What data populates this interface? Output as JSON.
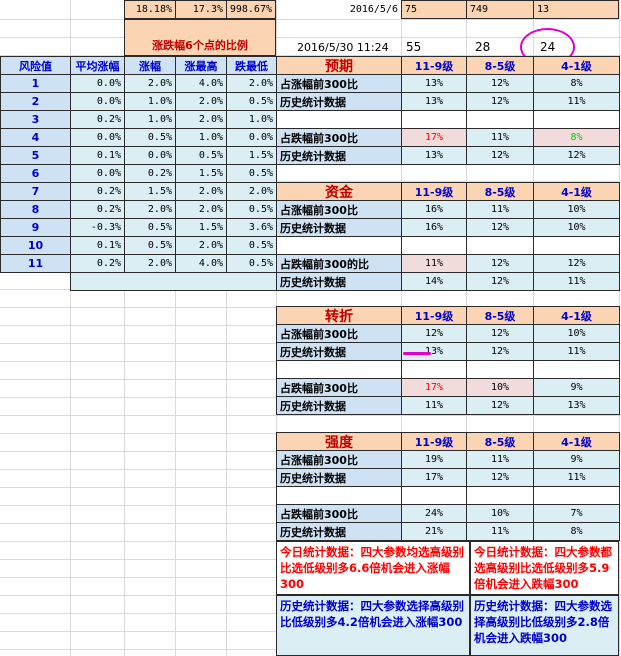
{
  "top_row": {
    "v1": "18.18%",
    "v2": "17.3%",
    "v3": "998.67%",
    "date": "2016/5/6",
    "a": "75",
    "b": "749",
    "c": "13"
  },
  "second_row": {
    "ratio_label": "涨跌幅6个点的比例",
    "datetime": "2016/5/30  11:24",
    "a": "55",
    "b": "28",
    "c": "24"
  },
  "left_table": {
    "headers": [
      "风险值",
      "平均涨幅",
      "涨幅",
      "涨最高",
      "跌最低"
    ],
    "rows": [
      [
        "1",
        "0.0%",
        "2.0%",
        "4.0%",
        "2.0%"
      ],
      [
        "2",
        "0.0%",
        "1.0%",
        "2.0%",
        "0.5%"
      ],
      [
        "3",
        "0.2%",
        "1.0%",
        "2.0%",
        "1.0%"
      ],
      [
        "4",
        "0.0%",
        "0.5%",
        "1.0%",
        "0.0%"
      ],
      [
        "5",
        "0.1%",
        "0.0%",
        "0.5%",
        "1.5%"
      ],
      [
        "6",
        "0.0%",
        "0.2%",
        "1.5%",
        "0.5%"
      ],
      [
        "7",
        "0.2%",
        "1.5%",
        "2.0%",
        "2.0%"
      ],
      [
        "8",
        "0.2%",
        "2.0%",
        "2.0%",
        "0.5%"
      ],
      [
        "9",
        "-0.3%",
        "0.5%",
        "1.5%",
        "3.6%"
      ],
      [
        "10",
        "0.1%",
        "0.5%",
        "2.0%",
        "0.5%"
      ],
      [
        "11",
        "0.2%",
        "2.0%",
        "4.0%",
        "0.5%"
      ]
    ]
  },
  "level_headers": [
    "11-9级",
    "8-5级",
    "4-1级"
  ],
  "sections": [
    {
      "title": "预期",
      "rows": [
        {
          "label": "占涨幅前300比",
          "vals": [
            "13%",
            "12%",
            "8%"
          ]
        },
        {
          "label": "历史统计数据",
          "vals": [
            "13%",
            "12%",
            "11%"
          ]
        },
        {
          "label": "",
          "vals": [
            "",
            "",
            ""
          ]
        },
        {
          "label": "占跌幅前300比",
          "vals": [
            "17%",
            "11%",
            "8%"
          ]
        },
        {
          "label": "历史统计数据",
          "vals": [
            "13%",
            "12%",
            "12%"
          ]
        }
      ]
    },
    {
      "title": "资金",
      "rows": [
        {
          "label": "占涨幅前300比",
          "vals": [
            "16%",
            "11%",
            "10%"
          ]
        },
        {
          "label": "历史统计数据",
          "vals": [
            "16%",
            "12%",
            "10%"
          ]
        },
        {
          "label": "",
          "vals": [
            "",
            "",
            ""
          ]
        },
        {
          "label": "占跌幅前300的比",
          "vals": [
            "11%",
            "12%",
            "12%"
          ]
        },
        {
          "label": "历史统计数据",
          "vals": [
            "14%",
            "12%",
            "11%"
          ]
        }
      ]
    },
    {
      "title": "转折",
      "rows": [
        {
          "label": "占涨幅前300比",
          "vals": [
            "12%",
            "12%",
            "10%"
          ]
        },
        {
          "label": "历史统计数据",
          "vals": [
            "13%",
            "12%",
            "11%"
          ]
        },
        {
          "label": "",
          "vals": [
            "",
            "",
            ""
          ]
        },
        {
          "label": "占跌幅前300比",
          "vals": [
            "17%",
            "10%",
            "9%"
          ]
        },
        {
          "label": "历史统计数据",
          "vals": [
            "11%",
            "12%",
            "13%"
          ]
        }
      ]
    },
    {
      "title": "强度",
      "rows": [
        {
          "label": "占涨幅前300比",
          "vals": [
            "19%",
            "11%",
            "9%"
          ]
        },
        {
          "label": "历史统计数据",
          "vals": [
            "17%",
            "12%",
            "11%"
          ]
        },
        {
          "label": "",
          "vals": [
            "",
            "",
            ""
          ]
        },
        {
          "label": "占跌幅前300比",
          "vals": [
            "24%",
            "10%",
            "7%"
          ]
        },
        {
          "label": "历史统计数据",
          "vals": [
            "21%",
            "11%",
            "8%"
          ]
        }
      ]
    }
  ],
  "notes": {
    "today_up": "今日统计数据：四大参数均选高级别比选低级别多6.6倍机会进入涨幅300",
    "today_down": "今日统计数据：四大参数都选高级别比选低级别多5.9倍机会进入跌幅300",
    "hist_up": "历史统计数据：四大参数选择高级别比低级别多4.2倍机会进入涨幅300",
    "hist_down": "历史统计数据：四大参数选择高级别比低级别多2.8倍机会进入跌幅300"
  },
  "colors": {
    "accent_red": "#c00000",
    "header_peach": "#fbd4b4",
    "label_blue": "#cfe2f3",
    "circle_magenta": "#e000c8"
  }
}
